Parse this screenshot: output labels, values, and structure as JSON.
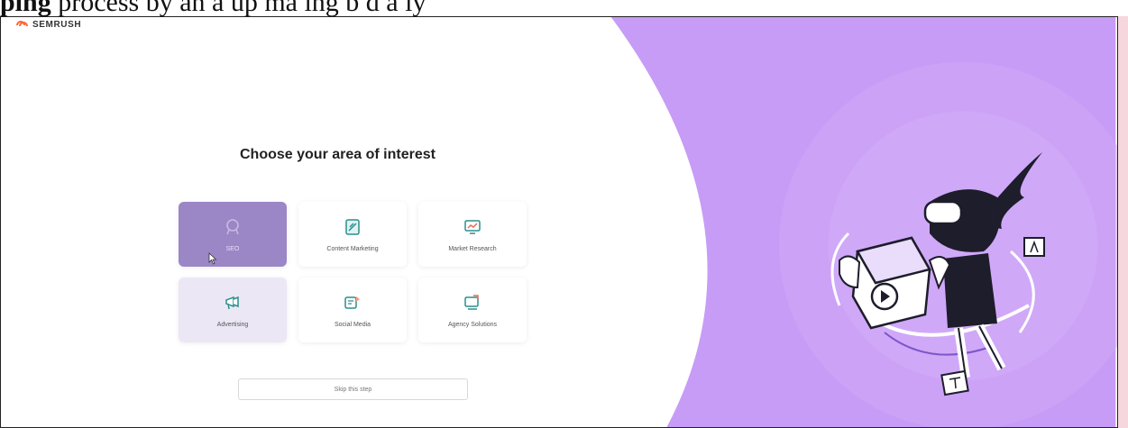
{
  "caption": {
    "bold": "ping",
    "text": " process by an a   up ma     ing b    d a ly"
  },
  "logo": {
    "text": "SEMRUSH"
  },
  "page": {
    "heading": "Choose your area of interest",
    "skip_label": "Skip this step"
  },
  "options": [
    {
      "label": "SEO",
      "icon": "seo-icon",
      "state": "selected"
    },
    {
      "label": "Content Marketing",
      "icon": "content-marketing-icon",
      "state": "default"
    },
    {
      "label": "Market Research",
      "icon": "market-research-icon",
      "state": "default"
    },
    {
      "label": "Advertising",
      "icon": "advertising-icon",
      "state": "hover"
    },
    {
      "label": "Social Media",
      "icon": "social-media-icon",
      "state": "default"
    },
    {
      "label": "Agency Solutions",
      "icon": "agency-solutions-icon",
      "state": "default"
    }
  ],
  "colors": {
    "accent_purple": "#c79cf6",
    "selected_card": "#9b86c6",
    "brand_orange": "#ff642d",
    "icon_teal": "#2a8f8b"
  }
}
